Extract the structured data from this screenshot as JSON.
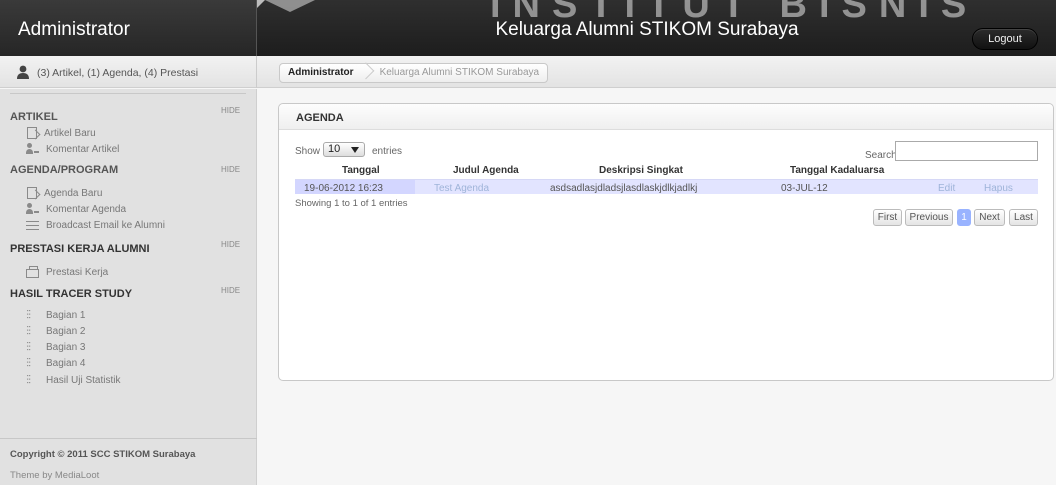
{
  "header": {
    "admin_title": "Administrator",
    "site_title": "Keluarga Alumni STIKOM Surabaya",
    "watermark": "INSTITUT BISNIS",
    "logout_label": "Logout"
  },
  "user_info": "(3) Artikel, (1) Agenda, (4) Prestasi",
  "breadcrumb": [
    "Administrator",
    "Keluarga Alumni STIKOM Surabaya"
  ],
  "sidebar": {
    "hide_label": "HIDE",
    "sections": [
      {
        "title": "ARTIKEL",
        "items": [
          {
            "label": "Artikel Baru",
            "icon": "new-document-icon"
          },
          {
            "label": "Komentar Artikel",
            "icon": "users-icon"
          }
        ]
      },
      {
        "title": "AGENDA/PROGRAM",
        "items": [
          {
            "label": "Agenda Baru",
            "icon": "new-document-icon"
          },
          {
            "label": "Komentar Agenda",
            "icon": "users-icon"
          },
          {
            "label": "Broadcast Email ke Alumni",
            "icon": "list-icon"
          }
        ]
      },
      {
        "title": "PRESTASI KERJA ALUMNI",
        "items": [
          {
            "label": "Prestasi Kerja",
            "icon": "folder-icon"
          }
        ]
      },
      {
        "title": "HASIL TRACER STUDY",
        "items": [
          {
            "label": "Bagian 1",
            "icon": "sliders-icon"
          },
          {
            "label": "Bagian 2",
            "icon": "sliders-icon"
          },
          {
            "label": "Bagian 3",
            "icon": "sliders-icon"
          },
          {
            "label": "Bagian 4",
            "icon": "sliders-icon"
          },
          {
            "label": "Hasil Uji Statistik",
            "icon": "sliders-icon"
          }
        ]
      }
    ],
    "copyright": "Copyright © 2011 SCC STIKOM Surabaya",
    "theme": "Theme by MediaLoot"
  },
  "panel": {
    "title": "AGENDA",
    "show_label": "Show",
    "length_value": "10",
    "entries_label": "entries",
    "search_label": "Search:",
    "columns": [
      "Tanggal",
      "Judul Agenda",
      "Deskripsi Singkat",
      "Tanggal Kadaluarsa"
    ],
    "rows": [
      {
        "tanggal": "19-06-2012 16:23",
        "judul": "Test Agenda",
        "deskripsi": "asdsadlasjdladsjlasdlaskjdlkjadlkj",
        "kadaluarsa": "03-JUL-12",
        "edit": "Edit",
        "hapus": "Hapus"
      }
    ],
    "info": "Showing 1 to 1 of 1 entries",
    "pagination": {
      "first": "First",
      "previous": "Previous",
      "current": "1",
      "next": "Next",
      "last": "Last"
    }
  },
  "colors": {
    "header_bg": "#222222",
    "sidebar_bg": "#e1e1e1",
    "row_highlight": "#e2e4ff",
    "link": "#9fb4d9",
    "current_page": "#99b3ff"
  }
}
